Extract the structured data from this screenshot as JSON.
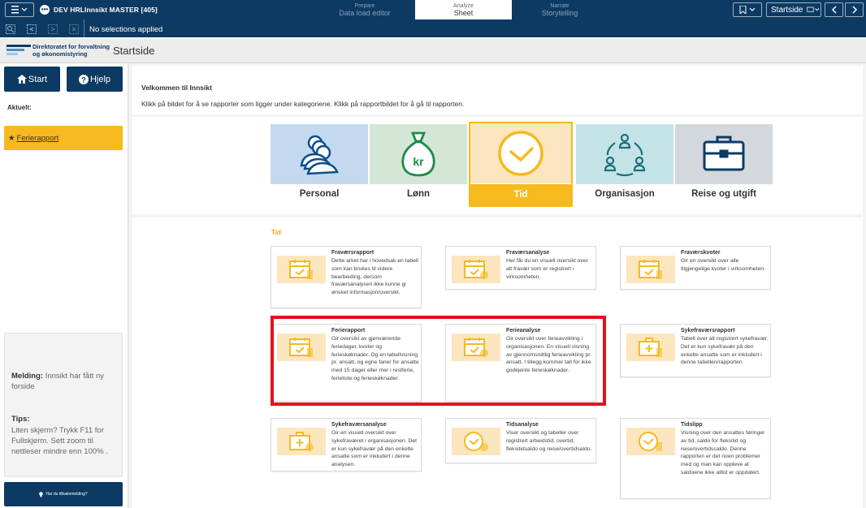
{
  "topbar": {
    "app_title": "DEV HRLInnsikt MASTER [405]",
    "tabs": [
      {
        "small": "Prepare",
        "label": "Data load editor"
      },
      {
        "small": "Analyze",
        "label": "Sheet"
      },
      {
        "small": "Narrate",
        "label": "Storytelling"
      }
    ],
    "sheet_label": "Startside"
  },
  "selections": {
    "text": "No selections applied"
  },
  "header": {
    "org_line1": "Direktoratet for forvaltning",
    "org_line2": "og økonomistyring",
    "page_title": "Startside"
  },
  "sidebar": {
    "start_label": "Start",
    "help_label": "Hjelp",
    "current_label": "Aktuelt:",
    "current_report": "Ferierapport",
    "message_label": "Melding:",
    "message_text": "Innsikt har fått ny forside",
    "tips_label": "Tips:",
    "tips_text": "Liten skjerm? Trykk F11 for Fullskjerm. Sett zoom til nettleser mindre enn 100% .",
    "feedback_label": "Har du tilbakemelding?"
  },
  "welcome": {
    "title": "Velkommen til Innsikt",
    "description": "Klikk på bildet for å se rapporter som ligger under kategoriene. Klikk på rapportbildet for å gå til rapporten."
  },
  "categories": [
    {
      "label": "Personal"
    },
    {
      "label": "Lønn",
      "icon_text": "kr"
    },
    {
      "label": "Tid",
      "selected": true
    },
    {
      "label": "Organisasjon"
    },
    {
      "label": "Reise og utgift"
    }
  ],
  "section_label": "Tid",
  "reports": [
    {
      "title": "Fraværsrapport",
      "icon": "calendar-check-icon",
      "description": "Dette arket har i hovedsak en tabell som kan brukes til videre bearbeiding, dersom fraværsanalysen ikke kunne gi ønsket informasjon/oversikt."
    },
    {
      "title": "Fraværsanalyse",
      "icon": "calendar-check-icon",
      "description": "Her får du en visuell oversikt over alt fravær som er registrert i virksomheten."
    },
    {
      "title": "Fraværskvoter",
      "icon": "calendar-check-icon",
      "description": "Gir en oversikt over alle tilgjengelige kvoter i virksomheten."
    },
    {
      "title": "Ferierapport",
      "icon": "calendar-check-icon",
      "description": "Gir oversikt av gjenværende feriedager, kvoter og ferieskøknader. Og en tabellvisning pr. ansatt, og egne faner for ansatte med 15 dager eller mer i restferie, ferieliste og ferieskøknader."
    },
    {
      "title": "Ferieanalyse",
      "icon": "calendar-check-icon",
      "description": "Gir oversikt over ferieavvikling i organisasjonen. En visuell visning av gjennomsnittlig ferieavvikling pr. ansatt. I tillegg kommer tall for ikke godkjente ferieskøknader."
    },
    {
      "title": "Sykefraværsrapport",
      "icon": "medical-kit-icon",
      "description": "Tabell over alt registrert sykefravær. Det er kun sykefravær på den enkelte ansatte som er inkludert i denne tabellen/rapporten."
    },
    {
      "title": "Sykefraværsanalyse",
      "icon": "medical-kit-icon",
      "description": "Gir en visuell oversikt over sykefraværet i organisasjonen. Det er kun sykefravær på den enkelte ansatte som er inkludert i denne analysen."
    },
    {
      "title": "Tidsanalyse",
      "icon": "clock-icon",
      "description": "Viser oversikt og tabeller over registrert arbeidstid, overtid, fleksitidsaldo og reise/overtidsaldo."
    },
    {
      "title": "Tidslipp",
      "icon": "clock-icon",
      "description": "Visning over den ansattes føringer av tid, saldo for fleksitid og reise/overtidssaldo. Denne rapporten er det noen problemer med og man kan oppleve at saldoene ikke alltid er oppdatert."
    }
  ],
  "colors": {
    "navy": "#0d3a63",
    "accent": "#f6ba1e",
    "highlight": "#e3121c"
  }
}
